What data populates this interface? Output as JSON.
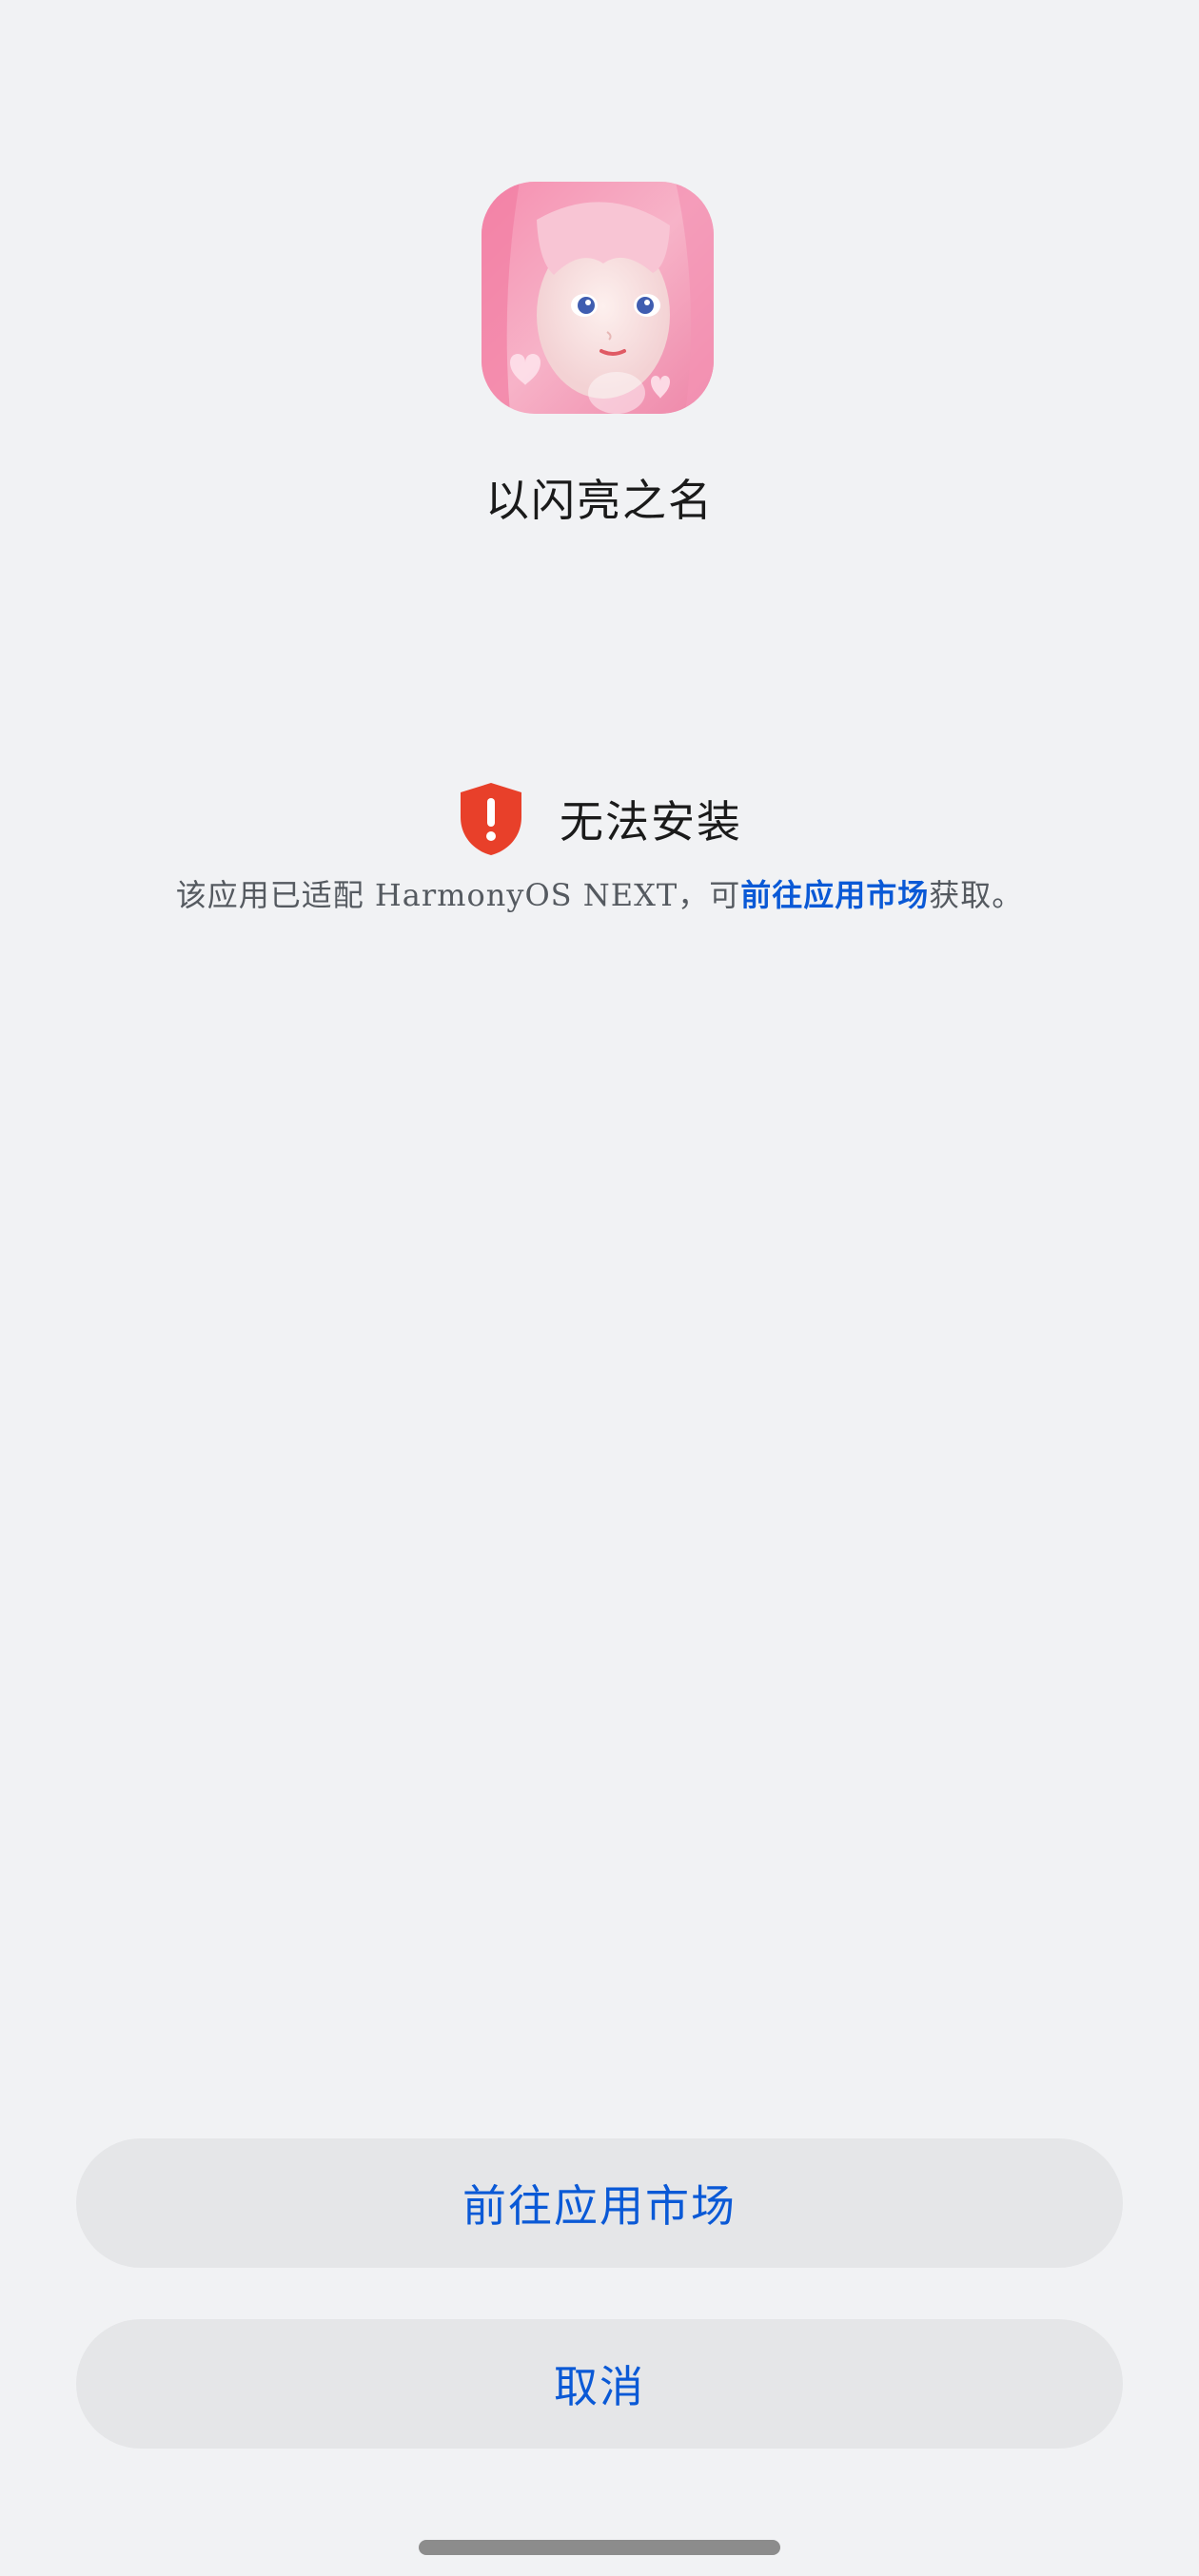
{
  "app": {
    "name": "以闪亮之名",
    "icon": "app-icon"
  },
  "status": {
    "icon": "shield-alert-icon",
    "title": "无法安装",
    "description_prefix": "该应用已适配 HarmonyOS NEXT，可",
    "description_link": "前往应用市场",
    "description_suffix": "获取。"
  },
  "actions": {
    "market_label": "前往应用市场",
    "cancel_label": "取消"
  },
  "colors": {
    "background": "#f1f2f4",
    "accent": "#0a59d6",
    "warning": "#e8402a",
    "button_bg": "#e5e6e8"
  }
}
